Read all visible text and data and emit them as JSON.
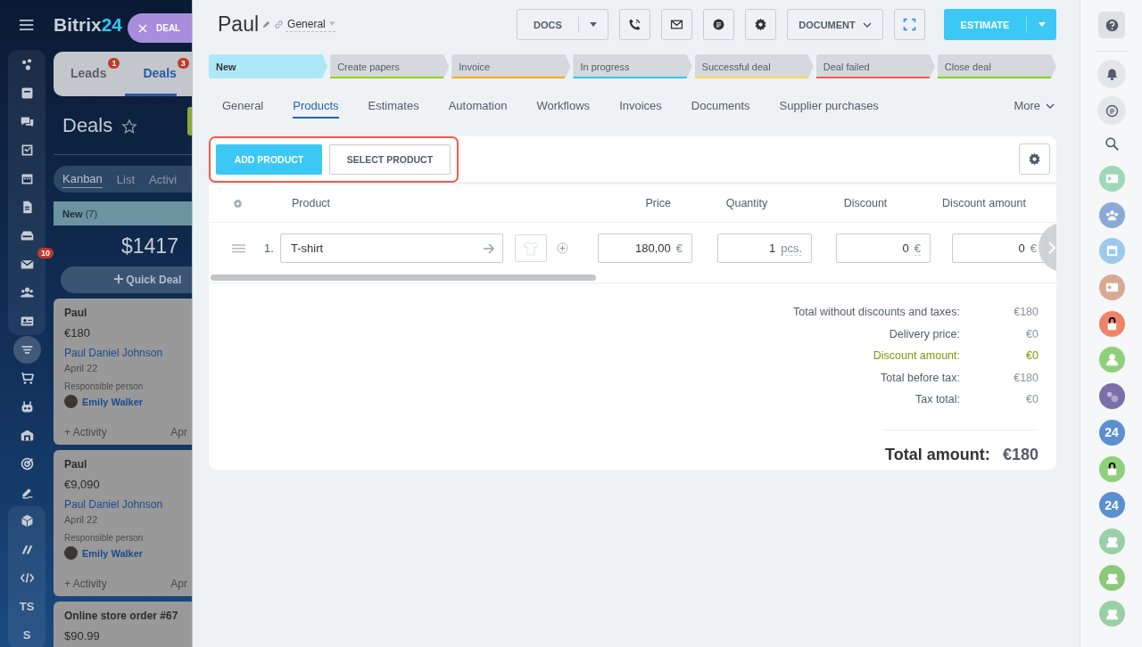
{
  "logo": {
    "name": "Bitrix",
    "suffix": "24"
  },
  "close_tab": {
    "label": "DEAL"
  },
  "nav": {
    "items": [
      {
        "kind": "icon",
        "selected": false
      },
      {
        "kind": "icon",
        "selected": false
      },
      {
        "kind": "icon",
        "selected": false
      },
      {
        "kind": "icon",
        "selected": false
      },
      {
        "kind": "icon",
        "selected": false
      },
      {
        "kind": "icon",
        "selected": false
      },
      {
        "kind": "icon",
        "selected": false
      },
      {
        "kind": "icon",
        "selected": false,
        "badge": "10"
      },
      {
        "kind": "icon",
        "selected": false
      },
      {
        "kind": "icon",
        "selected": false
      },
      {
        "kind": "icon",
        "selected": true
      },
      {
        "kind": "icon",
        "selected": false
      },
      {
        "kind": "icon",
        "selected": false
      },
      {
        "kind": "icon",
        "selected": false
      },
      {
        "kind": "icon",
        "selected": false
      },
      {
        "kind": "icon",
        "selected": false
      },
      {
        "kind": "icon",
        "selected": false
      },
      {
        "kind": "icon",
        "selected": false
      },
      {
        "kind": "icon",
        "selected": false
      },
      {
        "kind": "text",
        "label": "TS",
        "selected": false
      },
      {
        "kind": "text",
        "label": "S",
        "selected": false
      }
    ]
  },
  "crm_tabs": [
    {
      "label": "Leads",
      "badge": "1",
      "selected": false
    },
    {
      "label": "Deals",
      "badge": "3",
      "selected": true
    }
  ],
  "page_title": "Deals",
  "views": [
    {
      "label": "Kanban",
      "selected": true
    },
    {
      "label": "List",
      "selected": false
    },
    {
      "label": "Activi",
      "selected": false
    }
  ],
  "column": {
    "name": "New",
    "count": "(7)",
    "sum": "$1417",
    "quick": "Quick Deal"
  },
  "cards": [
    {
      "title": "Paul",
      "amount": "€180",
      "contact": "Paul Daniel Johnson",
      "date": "April 22",
      "resp_label": "Responsible person",
      "resp": "Emily Walker",
      "activity": "+ Activity",
      "due": "Apr"
    },
    {
      "title": "Paul",
      "amount": "€9,090",
      "contact": "Paul Daniel Johnson",
      "date": "April 22",
      "resp_label": "Responsible person",
      "resp": "Emily Walker",
      "activity": "+ Activity",
      "due": "Apr"
    },
    {
      "title": "Online store order #67",
      "amount": "$90.99"
    }
  ],
  "deal": {
    "title": "Paul",
    "category": "General"
  },
  "actions": {
    "docs": "DOCS",
    "document": "DOCUMENT",
    "estimate": "ESTIMATE"
  },
  "stages": [
    {
      "label": "New",
      "color": "#aee8f8",
      "selected": true
    },
    {
      "label": "Create papers",
      "color": "#8fd400",
      "selected": false
    },
    {
      "label": "Invoice",
      "color": "#ffa900",
      "selected": false
    },
    {
      "label": "In progress",
      "color": "#2fc6f6",
      "selected": false
    },
    {
      "label": "Successful deal",
      "color": "#ffd84d",
      "selected": false
    },
    {
      "label": "Deal failed",
      "color": "#ff5752",
      "selected": false
    },
    {
      "label": "Close deal",
      "color": "#7bd500",
      "selected": false
    }
  ],
  "tabs": [
    {
      "label": "General",
      "selected": false
    },
    {
      "label": "Products",
      "selected": true
    },
    {
      "label": "Estimates",
      "selected": false
    },
    {
      "label": "Automation",
      "selected": false
    },
    {
      "label": "Workflows",
      "selected": false
    },
    {
      "label": "Invoices",
      "selected": false
    },
    {
      "label": "Documents",
      "selected": false
    },
    {
      "label": "Supplier purchases",
      "selected": false
    }
  ],
  "more_tab": "More",
  "toolbar": {
    "add": "ADD PRODUCT",
    "select": "SELECT PRODUCT"
  },
  "table": {
    "columns": [
      "Product",
      "Price",
      "Quantity",
      "Discount",
      "Discount amount"
    ],
    "rows": [
      {
        "number": "1.",
        "product": "T-shirt",
        "price": "180,00",
        "price_unit": "€",
        "quantity": "1",
        "quantity_unit": "pcs.",
        "discount": "0",
        "discount_unit": "€",
        "discount_amount": "0",
        "discount_amount_unit": "€"
      }
    ]
  },
  "totals": [
    {
      "label": "Total without discounts and taxes:",
      "value": "€180",
      "highlighted": false
    },
    {
      "label": "Delivery price:",
      "value": "€0",
      "highlighted": false
    },
    {
      "label": "Discount amount:",
      "value": "€0",
      "highlighted": true
    },
    {
      "label": "Total before tax:",
      "value": "€180",
      "highlighted": false
    },
    {
      "label": "Tax total:",
      "value": "€0",
      "highlighted": false
    }
  ],
  "total": {
    "label": "Total amount:",
    "value": "€180"
  },
  "rail": [
    {
      "color": "#9fd7b9"
    },
    {
      "color": "#8aa9d6"
    },
    {
      "color": "#9dc9ec"
    },
    {
      "color": "#d7a993"
    },
    {
      "color": "#f0836b"
    },
    {
      "color": "#8fd07a"
    },
    {
      "color": "#7a6fa8"
    },
    {
      "color": "#5a8fd1",
      "label": "24"
    },
    {
      "color": "#8fd07a"
    },
    {
      "color": "#5a8fd1",
      "label": "24"
    },
    {
      "color": "#9ad0a6"
    },
    {
      "color": "#8cc97a"
    },
    {
      "color": "#9ad0a6"
    }
  ]
}
